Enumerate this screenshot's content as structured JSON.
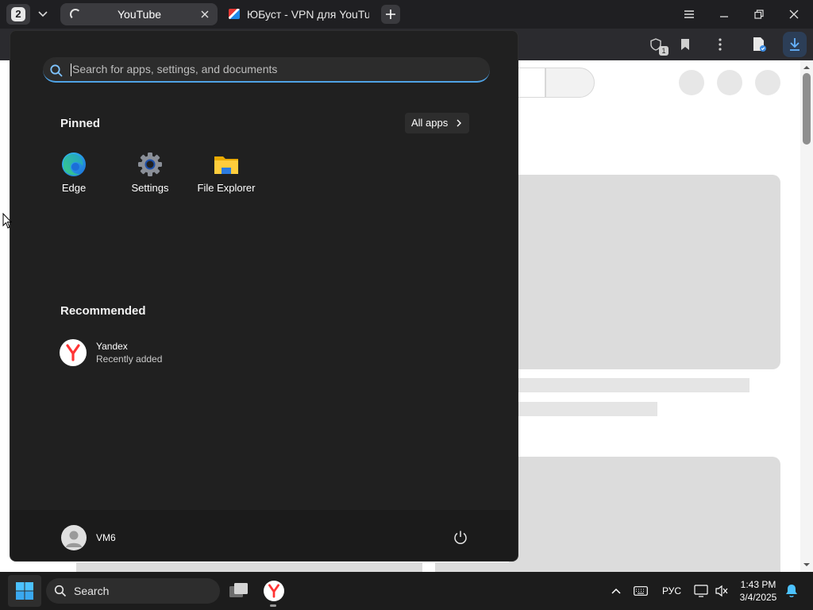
{
  "browser": {
    "tab_count": "2",
    "tabs": [
      {
        "title": "YouTube",
        "active": true
      },
      {
        "title": "ЮБуст - VPN для YouTube",
        "active": false
      }
    ],
    "extension_badge": "1"
  },
  "start_menu": {
    "search_placeholder": "Search for apps, settings, and documents",
    "pinned_title": "Pinned",
    "all_apps_label": "All apps",
    "pinned_apps": [
      {
        "label": "Edge",
        "icon": "edge-icon"
      },
      {
        "label": "Settings",
        "icon": "settings-gear-icon"
      },
      {
        "label": "File Explorer",
        "icon": "folder-icon"
      }
    ],
    "recommended_title": "Recommended",
    "recommended": [
      {
        "name": "Yandex",
        "subtitle": "Recently added",
        "icon": "yandex-icon"
      }
    ],
    "user_name": "VM6"
  },
  "taskbar": {
    "search_label": "Search",
    "language": "РУС",
    "time": "1:43 PM",
    "date": "3/4/2025"
  },
  "colors": {
    "start_bg": "#202020",
    "taskbar_bg": "#1c1c1c",
    "accent": "#4fa3e6",
    "yandex_red": "#f33"
  }
}
